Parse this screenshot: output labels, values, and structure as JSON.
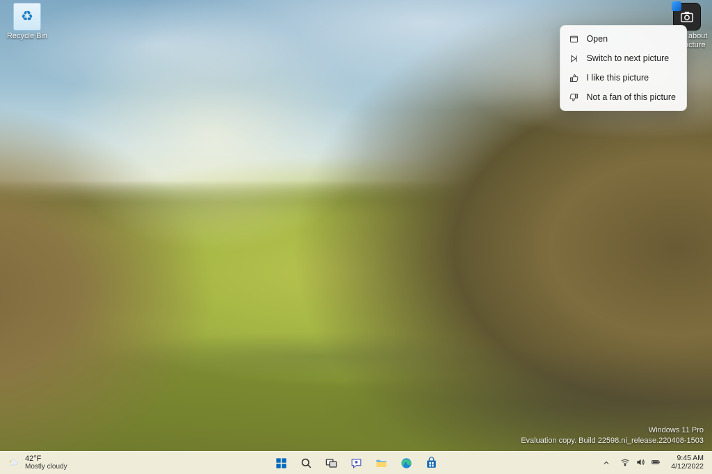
{
  "desktop": {
    "recycle_bin_label": "Recycle Bin",
    "spotlight_label": "Learn about this picture"
  },
  "context_menu": {
    "items": [
      {
        "icon": "open-icon",
        "label": "Open"
      },
      {
        "icon": "next-icon",
        "label": "Switch to next picture"
      },
      {
        "icon": "thumbs-up-icon",
        "label": "I like this picture"
      },
      {
        "icon": "thumbs-down-icon",
        "label": "Not a fan of this picture"
      }
    ]
  },
  "watermark": {
    "line1": "Windows 11 Pro",
    "line2": "Evaluation copy. Build 22598.ni_release.220408-1503"
  },
  "weather": {
    "temp": "42°F",
    "summary": "Mostly cloudy"
  },
  "taskbar": {
    "apps": [
      "start",
      "search",
      "task-view",
      "chat",
      "file-explorer",
      "edge",
      "store"
    ]
  },
  "systray": {
    "time": "9:45 AM",
    "date": "4/12/2022"
  },
  "colors": {
    "taskbar_bg": "#efecd9",
    "menu_bg": "#fafafaF5",
    "text": "#1a1a1a"
  }
}
